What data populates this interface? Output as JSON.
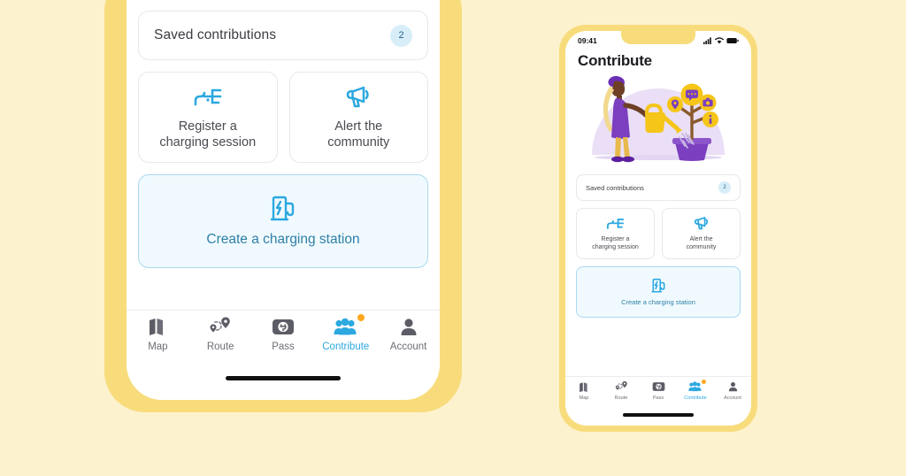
{
  "theme": {
    "page_background": "#FDF2CE",
    "phone_frame": "#F8DC7C",
    "accent_blue": "#2CA8E0",
    "accent_blue_dark": "#2F7FA8",
    "create_card_bg": "#F0FAFE",
    "create_card_border": "#A9D8EE",
    "badge_bg": "#D7EEF9",
    "badge_text": "#26658C",
    "notification_dot": "#FFA81E",
    "illustration_purple": "#7B3FBF",
    "illustration_yellow": "#F5C518",
    "tab_inactive": "#6E6E76"
  },
  "status_bar": {
    "time": "09:41",
    "signal_icon": "cellular-signal-icon",
    "wifi_icon": "wifi-icon",
    "battery_icon": "battery-icon"
  },
  "screen": {
    "title": "Contribute",
    "illustration_name": "woman-watering-contribution-tree-illustration",
    "illustration_alt": "Woman in purple dress watering a tree bearing yellow badge fruits",
    "saved_contributions": {
      "label": "Saved contributions",
      "count": "2"
    },
    "action_cards": [
      {
        "icon": "charging-cable-icon",
        "label_line1": "Register a",
        "label_line2": "charging session"
      },
      {
        "icon": "megaphone-icon",
        "label_line1": "Alert the",
        "label_line2": "community"
      }
    ],
    "create_station": {
      "icon": "charging-station-icon",
      "label": "Create a charging station"
    }
  },
  "tabbar": {
    "items": [
      {
        "label": "Map",
        "icon": "map-icon",
        "active": false,
        "notification": false
      },
      {
        "label": "Route",
        "icon": "route-icon",
        "active": false,
        "notification": false
      },
      {
        "label": "Pass",
        "icon": "pass-card-icon",
        "active": false,
        "notification": false
      },
      {
        "label": "Contribute",
        "icon": "contribute-people-icon",
        "active": true,
        "notification": true
      },
      {
        "label": "Account",
        "icon": "account-person-icon",
        "active": false,
        "notification": false
      }
    ]
  }
}
